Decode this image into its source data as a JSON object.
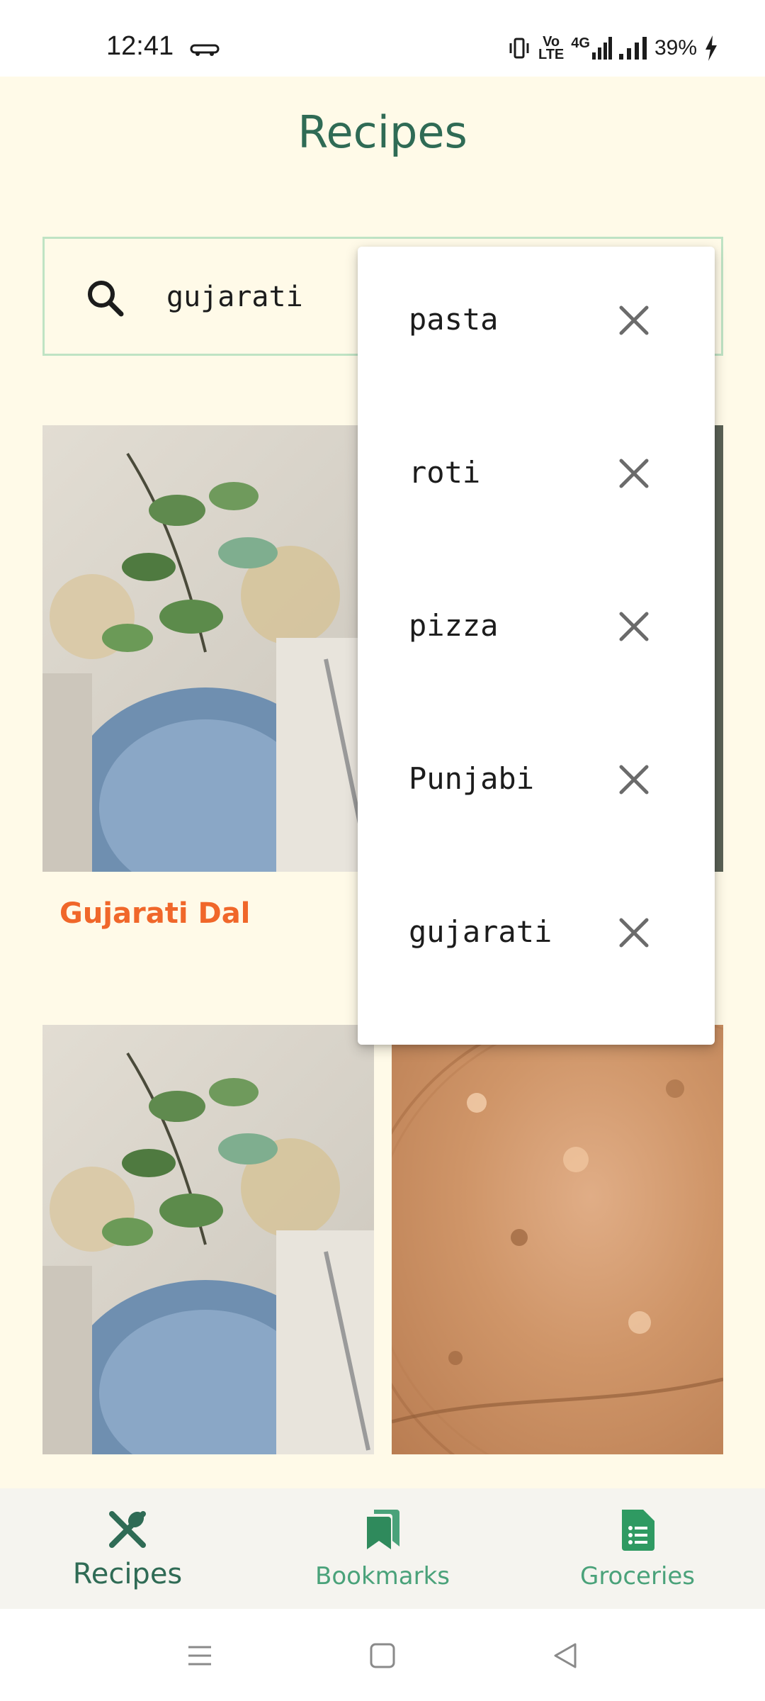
{
  "status_bar": {
    "time": "12:41",
    "network_top": "Vo",
    "network_bottom": "LTE",
    "network_4g": "4G",
    "battery": "39%"
  },
  "header": {
    "title": "Recipes"
  },
  "search": {
    "value": "gujarati",
    "placeholder": ""
  },
  "recipes": [
    {
      "title": "Gujarati Dal"
    }
  ],
  "dropdown": {
    "items": [
      {
        "label": "pasta"
      },
      {
        "label": "roti"
      },
      {
        "label": "pizza"
      },
      {
        "label": "Punjabi"
      },
      {
        "label": "gujarati"
      }
    ]
  },
  "bottom_nav": {
    "items": [
      {
        "label": "Recipes",
        "icon": "fork-knife-icon",
        "active": true
      },
      {
        "label": "Bookmarks",
        "icon": "bookmarks-icon",
        "active": false
      },
      {
        "label": "Groceries",
        "icon": "grocery-list-icon",
        "active": false
      }
    ]
  },
  "colors": {
    "background": "#fffae8",
    "brand_green": "#2f6b55",
    "accent_green": "#4aa27a",
    "recipe_title": "#f0672a",
    "search_border": "#bfe3c4"
  }
}
